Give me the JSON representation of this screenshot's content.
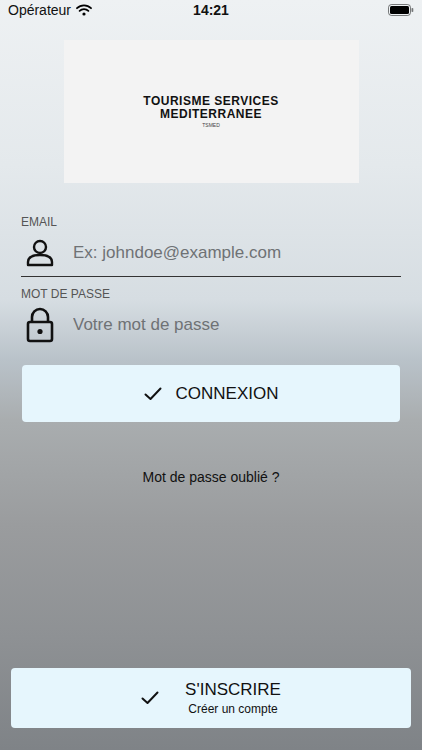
{
  "status_bar": {
    "carrier": "Opérateur",
    "time": "14:21"
  },
  "logo": {
    "lines": [
      "TOURISME SERVICES",
      "MEDITERRANEE"
    ],
    "subtitle": "TSMED"
  },
  "form": {
    "fields": [
      {
        "label": "EMAIL",
        "placeholder": "Ex: johndoe@example.com",
        "kind": "email"
      },
      {
        "label": "MOT DE PASSE",
        "placeholder": "Votre mot de passe",
        "kind": "password"
      }
    ]
  },
  "login_button": "CONNEXION",
  "forgot_link": "Mot de passe oublié ?",
  "register_button": {
    "label": "S'INSCRIRE",
    "sublabel": "Créer un compte"
  }
}
